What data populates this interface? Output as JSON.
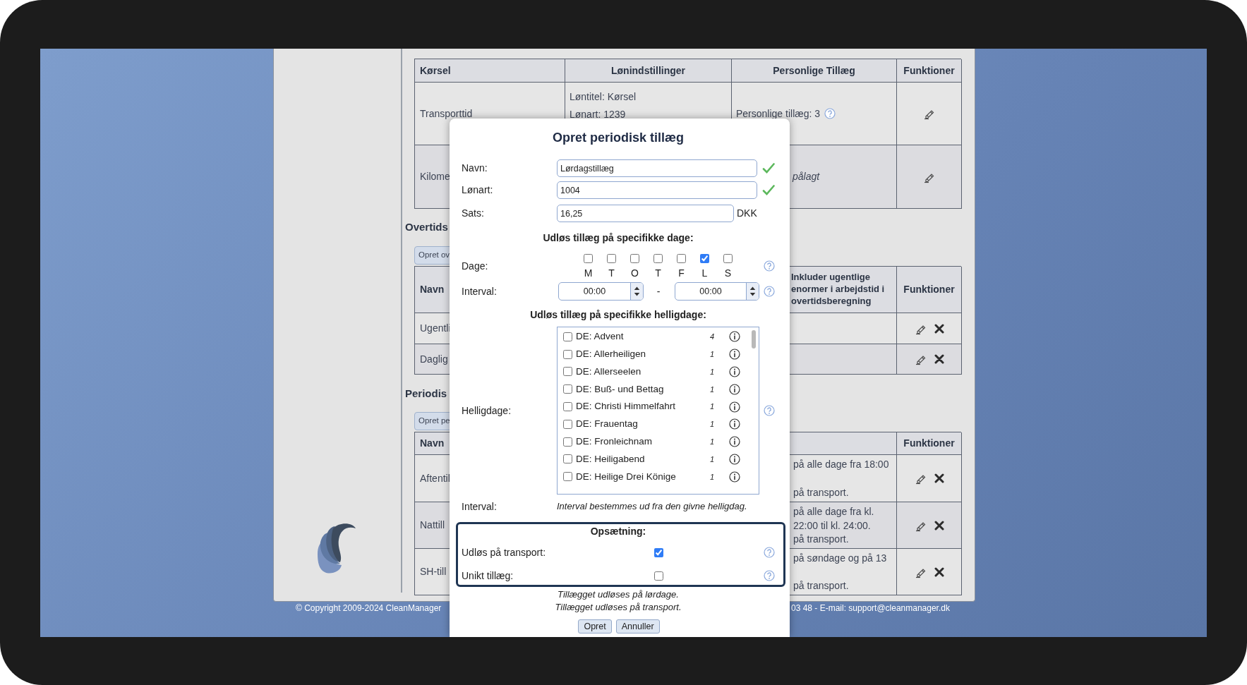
{
  "driving_table": {
    "columns": [
      "Kørsel",
      "Lønindstillinger",
      "Personlige Tillæg",
      "Funktioner"
    ],
    "rows": [
      {
        "name": "Transporttid",
        "pay_settings": [
          "Løntitel: Kørsel",
          "Lønart: 1239"
        ],
        "personal": "Personlige tillæg: 3",
        "kind": "count"
      },
      {
        "name": "Kilome",
        "personal": "pålagt",
        "kind": "note"
      }
    ]
  },
  "overtime": {
    "heading": "Overtids",
    "create_button": "Opret ov",
    "name_column": "Navn",
    "rule_column": [
      "Inkluder ugentlige",
      "enormer i arbejdstid i",
      "overtidsberegning"
    ],
    "functions_column": "Funktioner",
    "rows": [
      {
        "name": "Ugentli"
      },
      {
        "name": "Daglig"
      }
    ]
  },
  "periodic": {
    "heading": "Periodis",
    "create_button": "Opret pe",
    "name_column": "Navn",
    "functions_column": "Funktioner",
    "rows": [
      {
        "name": "Aftentil",
        "description": [
          "på alle dage fra 18:00",
          "på transport."
        ]
      },
      {
        "name": "Nattill",
        "description": [
          "på alle dage fra kl.",
          "22:00 til kl. 24:00.",
          "på transport."
        ]
      },
      {
        "name": "SH-till",
        "description": [
          "på søndage og på 13",
          "på transport."
        ]
      }
    ]
  },
  "footer": {
    "left": "© Copyright 2009-2024 CleanManager",
    "right": "03 48 - E-mail: support@cleanmanager.dk"
  },
  "dialog": {
    "title": "Opret periodisk tillæg",
    "fields": [
      {
        "label": "Navn:",
        "value": "Lørdagstillæg",
        "valid": true
      },
      {
        "label": "Lønart:",
        "value": "1004",
        "valid": true
      },
      {
        "label": "Sats:",
        "value": "16,25",
        "valid": false,
        "unit": "DKK"
      }
    ],
    "days_heading": "Udløs tillæg på specifikke dage:",
    "days_label": "Dage:",
    "days": [
      {
        "letter": "M",
        "checked": false
      },
      {
        "letter": "T",
        "checked": false
      },
      {
        "letter": "O",
        "checked": false
      },
      {
        "letter": "T",
        "checked": false
      },
      {
        "letter": "F",
        "checked": false
      },
      {
        "letter": "L",
        "checked": true
      },
      {
        "letter": "S",
        "checked": false
      }
    ],
    "interval_label": "Interval:",
    "interval_from": "00:00",
    "interval_separator": "-",
    "interval_to": "00:00",
    "holidays_heading": "Udløs tillæg på specifikke helligdage:",
    "holidays_label": "Helligdage:",
    "holidays": [
      {
        "name": "DE: Advent",
        "count": "4",
        "checked": false
      },
      {
        "name": "DE: Allerheiligen",
        "count": "1",
        "checked": false
      },
      {
        "name": "DE: Allerseelen",
        "count": "1",
        "checked": false
      },
      {
        "name": "DE: Buß- und Bettag",
        "count": "1",
        "checked": false
      },
      {
        "name": "DE: Christi Himmelfahrt",
        "count": "1",
        "checked": false
      },
      {
        "name": "DE: Frauentag",
        "count": "1",
        "checked": false
      },
      {
        "name": "DE: Fronleichnam",
        "count": "1",
        "checked": false
      },
      {
        "name": "DE: Heiligabend",
        "count": "1",
        "checked": false
      },
      {
        "name": "DE: Heilige Drei Könige",
        "count": "1",
        "checked": false
      }
    ],
    "holiday_interval_label": "Interval:",
    "holiday_interval_note": "Interval bestemmes ud fra den givne helligdag.",
    "setup": {
      "title": "Opsætning:",
      "options": [
        {
          "label": "Udløs på transport:",
          "checked": true
        },
        {
          "label": "Unikt tillæg:",
          "checked": false
        }
      ]
    },
    "summary": [
      "Tillægget udløses på lørdage.",
      "Tillægget udløses på transport."
    ],
    "buttons": [
      "Opret",
      "Annuller"
    ]
  }
}
